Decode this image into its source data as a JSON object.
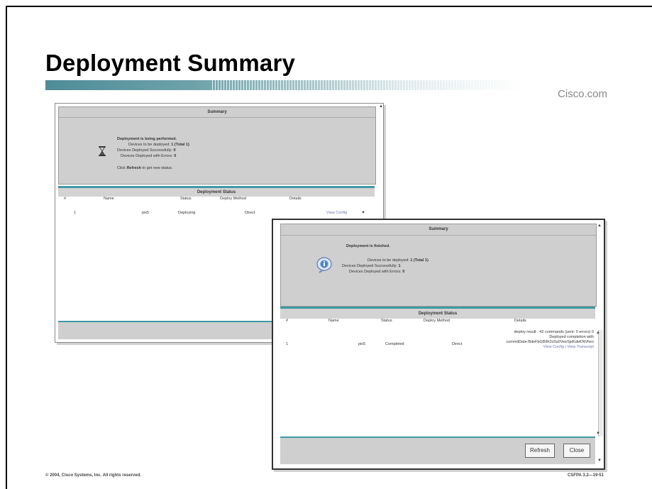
{
  "slide": {
    "title": "Deployment Summary",
    "brand": "Cisco.com",
    "footer_left": "© 2004, Cisco Systems, Inc. All rights reserved.",
    "footer_right": "CSFPA 3.2—19-51"
  },
  "window1": {
    "summary_heading": "Summary",
    "icon": "hourglass-icon",
    "deploy_msg": "Deployment is being performed.",
    "devices_to_deploy_label": "Devices to be deployed:",
    "devices_to_deploy_value": "1 (Total 1)",
    "deployed_success_label": "Devices Deployed Successfully:",
    "deployed_success_value": "0",
    "deployed_errors_label": "Devices Deployed with Errors:",
    "deployed_errors_value": "0",
    "refresh_hint_prefix": "Click",
    "refresh_hint_bold": "Refresh",
    "refresh_hint_suffix": "to get new status.",
    "status_heading": "Deployment Status",
    "columns": [
      "#",
      "Name",
      "Status",
      "Deploy Method",
      "Details"
    ],
    "rows": [
      {
        "num": "1",
        "name": "pix5",
        "status": "Deploying",
        "method": "Direct",
        "details": "View Config"
      }
    ]
  },
  "window2": {
    "summary_heading": "Summary",
    "icon": "info-icon",
    "deploy_msg": "Deployment is finished.",
    "devices_to_deploy_label": "Devices to be deployed:",
    "devices_to_deploy_value": "1 (Total 1)",
    "deployed_success_label": "Devices Deployed Successfully:",
    "deployed_success_value": "1",
    "deployed_errors_label": "Devices Deployed with Errors:",
    "deployed_errors_value": "0",
    "status_heading": "Deployment Status",
    "columns": [
      "#",
      "Name",
      "Status",
      "Deploy Method",
      "Details"
    ],
    "rows": [
      {
        "num": "1",
        "name": "pix5",
        "status": "Completed",
        "method": "Direct",
        "details_line1": "deploy result : 42 commands (sent: 0 errors) 0",
        "details_line2": "Deployed completion with",
        "details_line3": "commitDate:BdeFbGB9h2c0u0VeeSjeKdeKNVhex",
        "details_links": "View Config | View Transcript"
      }
    ],
    "refresh_button": "Refresh",
    "close_button": "Close"
  },
  "colors": {
    "accent": "#3f9aa5",
    "panel": "#cfcfcf",
    "link": "#6c76b8"
  }
}
